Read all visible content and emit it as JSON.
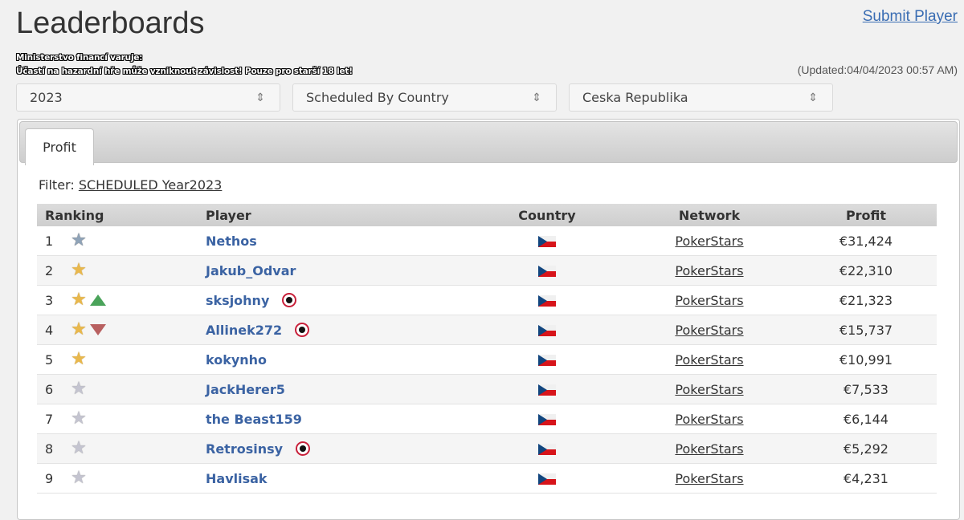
{
  "header": {
    "title": "Leaderboards",
    "submit_label": "Submit Player",
    "warning_line1": "Ministerstvo financí varuje:",
    "warning_line2": "Účastí na hazardní hře může vzniknout závislost! Pouze pro starší 18 let!",
    "updated": "(Updated:04/04/2023 00:57 AM)"
  },
  "selects": {
    "year": "2023",
    "type": "Scheduled By Country",
    "country": "Ceska Republika"
  },
  "tabs": [
    {
      "label": "Profit"
    }
  ],
  "filter": {
    "label": "Filter:",
    "value": "SCHEDULED Year2023"
  },
  "table": {
    "columns": [
      "Ranking",
      "Player",
      "Country",
      "Network",
      "Profit"
    ],
    "rows": [
      {
        "rank": "1",
        "star": "top-star-icon",
        "trend": "",
        "player": "Nethos",
        "ps": false,
        "country_flag": "czech-flag-icon",
        "network": "PokerStars",
        "profit": "€31,424"
      },
      {
        "rank": "2",
        "star": "gold-star-icon",
        "trend": "",
        "player": "Jakub_Odvar",
        "ps": false,
        "country_flag": "czech-flag-icon",
        "network": "PokerStars",
        "profit": "€22,310"
      },
      {
        "rank": "3",
        "star": "gold-star-icon",
        "trend": "up",
        "player": "sksjohny",
        "ps": true,
        "country_flag": "czech-flag-icon",
        "network": "PokerStars",
        "profit": "€21,323"
      },
      {
        "rank": "4",
        "star": "gold-star-icon",
        "trend": "down",
        "player": "Allinek272",
        "ps": true,
        "country_flag": "czech-flag-icon",
        "network": "PokerStars",
        "profit": "€15,737"
      },
      {
        "rank": "5",
        "star": "gold-star-icon",
        "trend": "",
        "player": "kokynho",
        "ps": false,
        "country_flag": "czech-flag-icon",
        "network": "PokerStars",
        "profit": "€10,991"
      },
      {
        "rank": "6",
        "star": "silver-star-icon",
        "trend": "",
        "player": "JackHerer5",
        "ps": false,
        "country_flag": "czech-flag-icon",
        "network": "PokerStars",
        "profit": "€7,533"
      },
      {
        "rank": "7",
        "star": "silver-star-icon",
        "trend": "",
        "player": "the Beast159",
        "ps": false,
        "country_flag": "czech-flag-icon",
        "network": "PokerStars",
        "profit": "€6,144"
      },
      {
        "rank": "8",
        "star": "silver-star-icon",
        "trend": "",
        "player": "Retrosinsy",
        "ps": true,
        "country_flag": "czech-flag-icon",
        "network": "PokerStars",
        "profit": "€5,292"
      },
      {
        "rank": "9",
        "star": "silver-star-icon",
        "trend": "",
        "player": "Havlisak",
        "ps": false,
        "country_flag": "czech-flag-icon",
        "network": "PokerStars",
        "profit": "€4,231"
      }
    ]
  },
  "colors": {
    "link": "#3b63a3",
    "gold_star": "#e9b84c",
    "up_arrow": "#4aa35a",
    "down_arrow": "#b86060"
  }
}
